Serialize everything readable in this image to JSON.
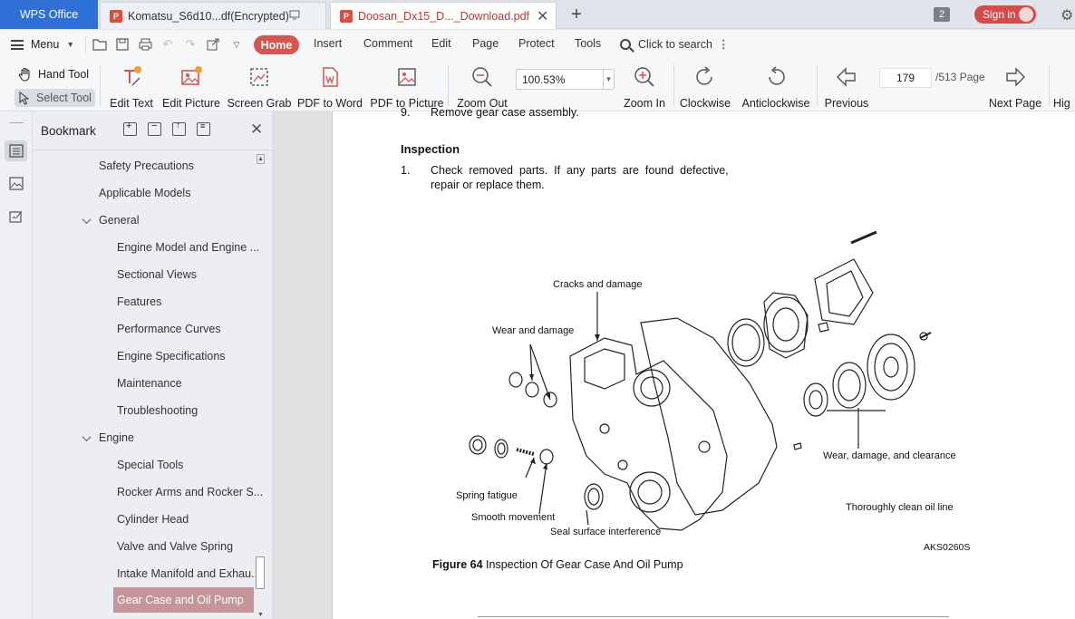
{
  "tabs": {
    "app_name": "WPS Office",
    "doc1_title": "Komatsu_S6d10...df(Encrypted)",
    "doc2_title": "Doosan_Dx15_D..._Download.pdf",
    "window_count": "2",
    "sign_in": "Sign in"
  },
  "menu": {
    "menu_label": "Menu",
    "tabs": [
      "Home",
      "Insert",
      "Comment",
      "Edit",
      "Page",
      "Protect",
      "Tools"
    ],
    "search_label": "Click to search"
  },
  "toolbar": {
    "hand_tool": "Hand Tool",
    "select_tool": "Select Tool",
    "edit_text": "Edit Text",
    "edit_picture": "Edit Picture",
    "screen_grab": "Screen Grab",
    "pdf_to_word": "PDF to Word",
    "pdf_to_picture": "PDF to Picture",
    "zoom_out": "Zoom Out",
    "zoom_value": "100.53%",
    "zoom_in": "Zoom In",
    "clockwise": "Clockwise",
    "anticlockwise": "Anticlockwise",
    "previous": "Previous",
    "page_current": "179",
    "page_total": "/513 Page",
    "next_page": "Next Page",
    "highlight_partial": "Hig"
  },
  "bookmark": {
    "title": "Bookmark",
    "items": [
      {
        "label": "Safety Precautions",
        "level": 1
      },
      {
        "label": "Applicable Models",
        "level": 1
      },
      {
        "label": "General",
        "level": 1,
        "expanded": true
      },
      {
        "label": "Engine Model and Engine ...",
        "level": 2
      },
      {
        "label": "Sectional Views",
        "level": 2
      },
      {
        "label": "Features",
        "level": 2
      },
      {
        "label": "Performance Curves",
        "level": 2
      },
      {
        "label": "Engine Specifications",
        "level": 2
      },
      {
        "label": "Maintenance",
        "level": 2
      },
      {
        "label": "Troubleshooting",
        "level": 2
      },
      {
        "label": "Engine",
        "level": 1,
        "expanded": true
      },
      {
        "label": "Special Tools",
        "level": 2
      },
      {
        "label": "Rocker Arms and Rocker S...",
        "level": 2
      },
      {
        "label": "Cylinder Head",
        "level": 2
      },
      {
        "label": "Valve and Valve Spring",
        "level": 2
      },
      {
        "label": "Intake Manifold and Exhau...",
        "level": 2
      },
      {
        "label": "Gear Case and Oil Pump",
        "level": 2,
        "selected": true
      }
    ]
  },
  "document": {
    "step9_num": "9.",
    "step9_text": "Remove gear case assembly.",
    "inspection_heading": "Inspection",
    "step1_num": "1.",
    "step1_line1": "Check  removed  parts.  If  any  parts  are  found  defective,",
    "step1_line2": "repair or replace them.",
    "callouts": {
      "cracks": "Cracks and damage",
      "wear": "Wear and damage",
      "spring": "Spring fatigue",
      "smooth": "Smooth movement",
      "seal": "Seal surface interference",
      "wear_clearance": "Wear, damage, and clearance",
      "oil_line": "Thoroughly clean oil line"
    },
    "figure_number": "Figure 64",
    "figure_title": " Inspection Of Gear Case And Oil Pump",
    "figure_code": "AKS0260S"
  },
  "colors": {
    "wps_blue": "#2e6fd8",
    "home_red": "#d9534f",
    "selected_bookmark": "#c5959b",
    "active_tab_text": "#c0392b"
  }
}
